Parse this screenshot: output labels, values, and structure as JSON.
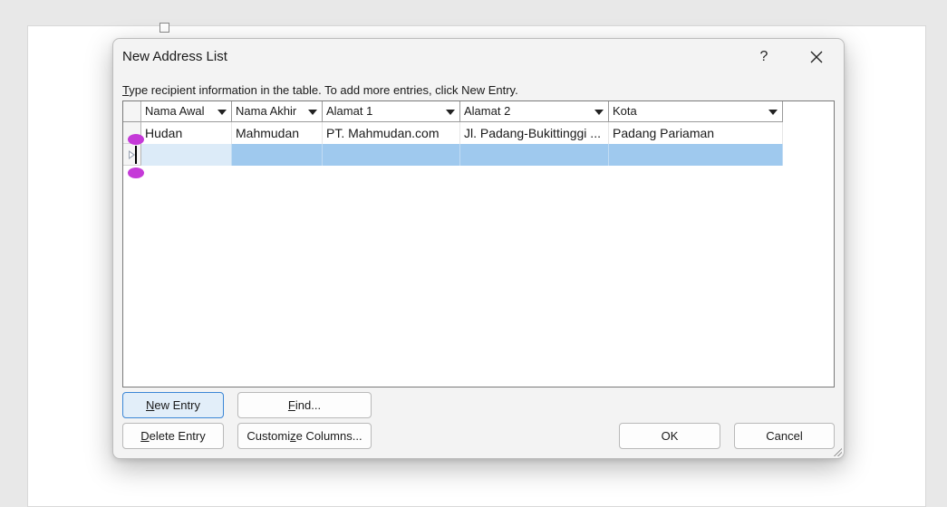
{
  "dialog": {
    "title": "New Address List",
    "help_label": "?",
    "instruction_accel": "T",
    "instruction_rest": "ype recipient information in the table.  To add more entries, click New Entry."
  },
  "table": {
    "columns": [
      "Nama Awal",
      "Nama Akhir",
      "Alamat 1",
      "Alamat 2",
      "Kota"
    ],
    "rows": [
      [
        "Hudan",
        "Mahmudan",
        "PT. Mahmudan.com",
        "Jl. Padang-Bukittinggi ...",
        "Padang Pariaman"
      ],
      [
        "",
        "",
        "",
        "",
        ""
      ]
    ]
  },
  "buttons": {
    "new_entry": {
      "accel": "N",
      "rest": "ew Entry"
    },
    "find": {
      "accel": "F",
      "rest": "ind..."
    },
    "delete_entry": {
      "accel": "D",
      "rest": "elete Entry"
    },
    "customize": {
      "pre": "Customi",
      "accel": "z",
      "rest": "e Columns..."
    },
    "ok": "OK",
    "cancel": "Cancel"
  },
  "colors": {
    "selected_row": "#9fc9ee",
    "active_cell": "#dcebf8",
    "primary_border": "#3b86d6",
    "touch_handle": "#c53ad8"
  }
}
